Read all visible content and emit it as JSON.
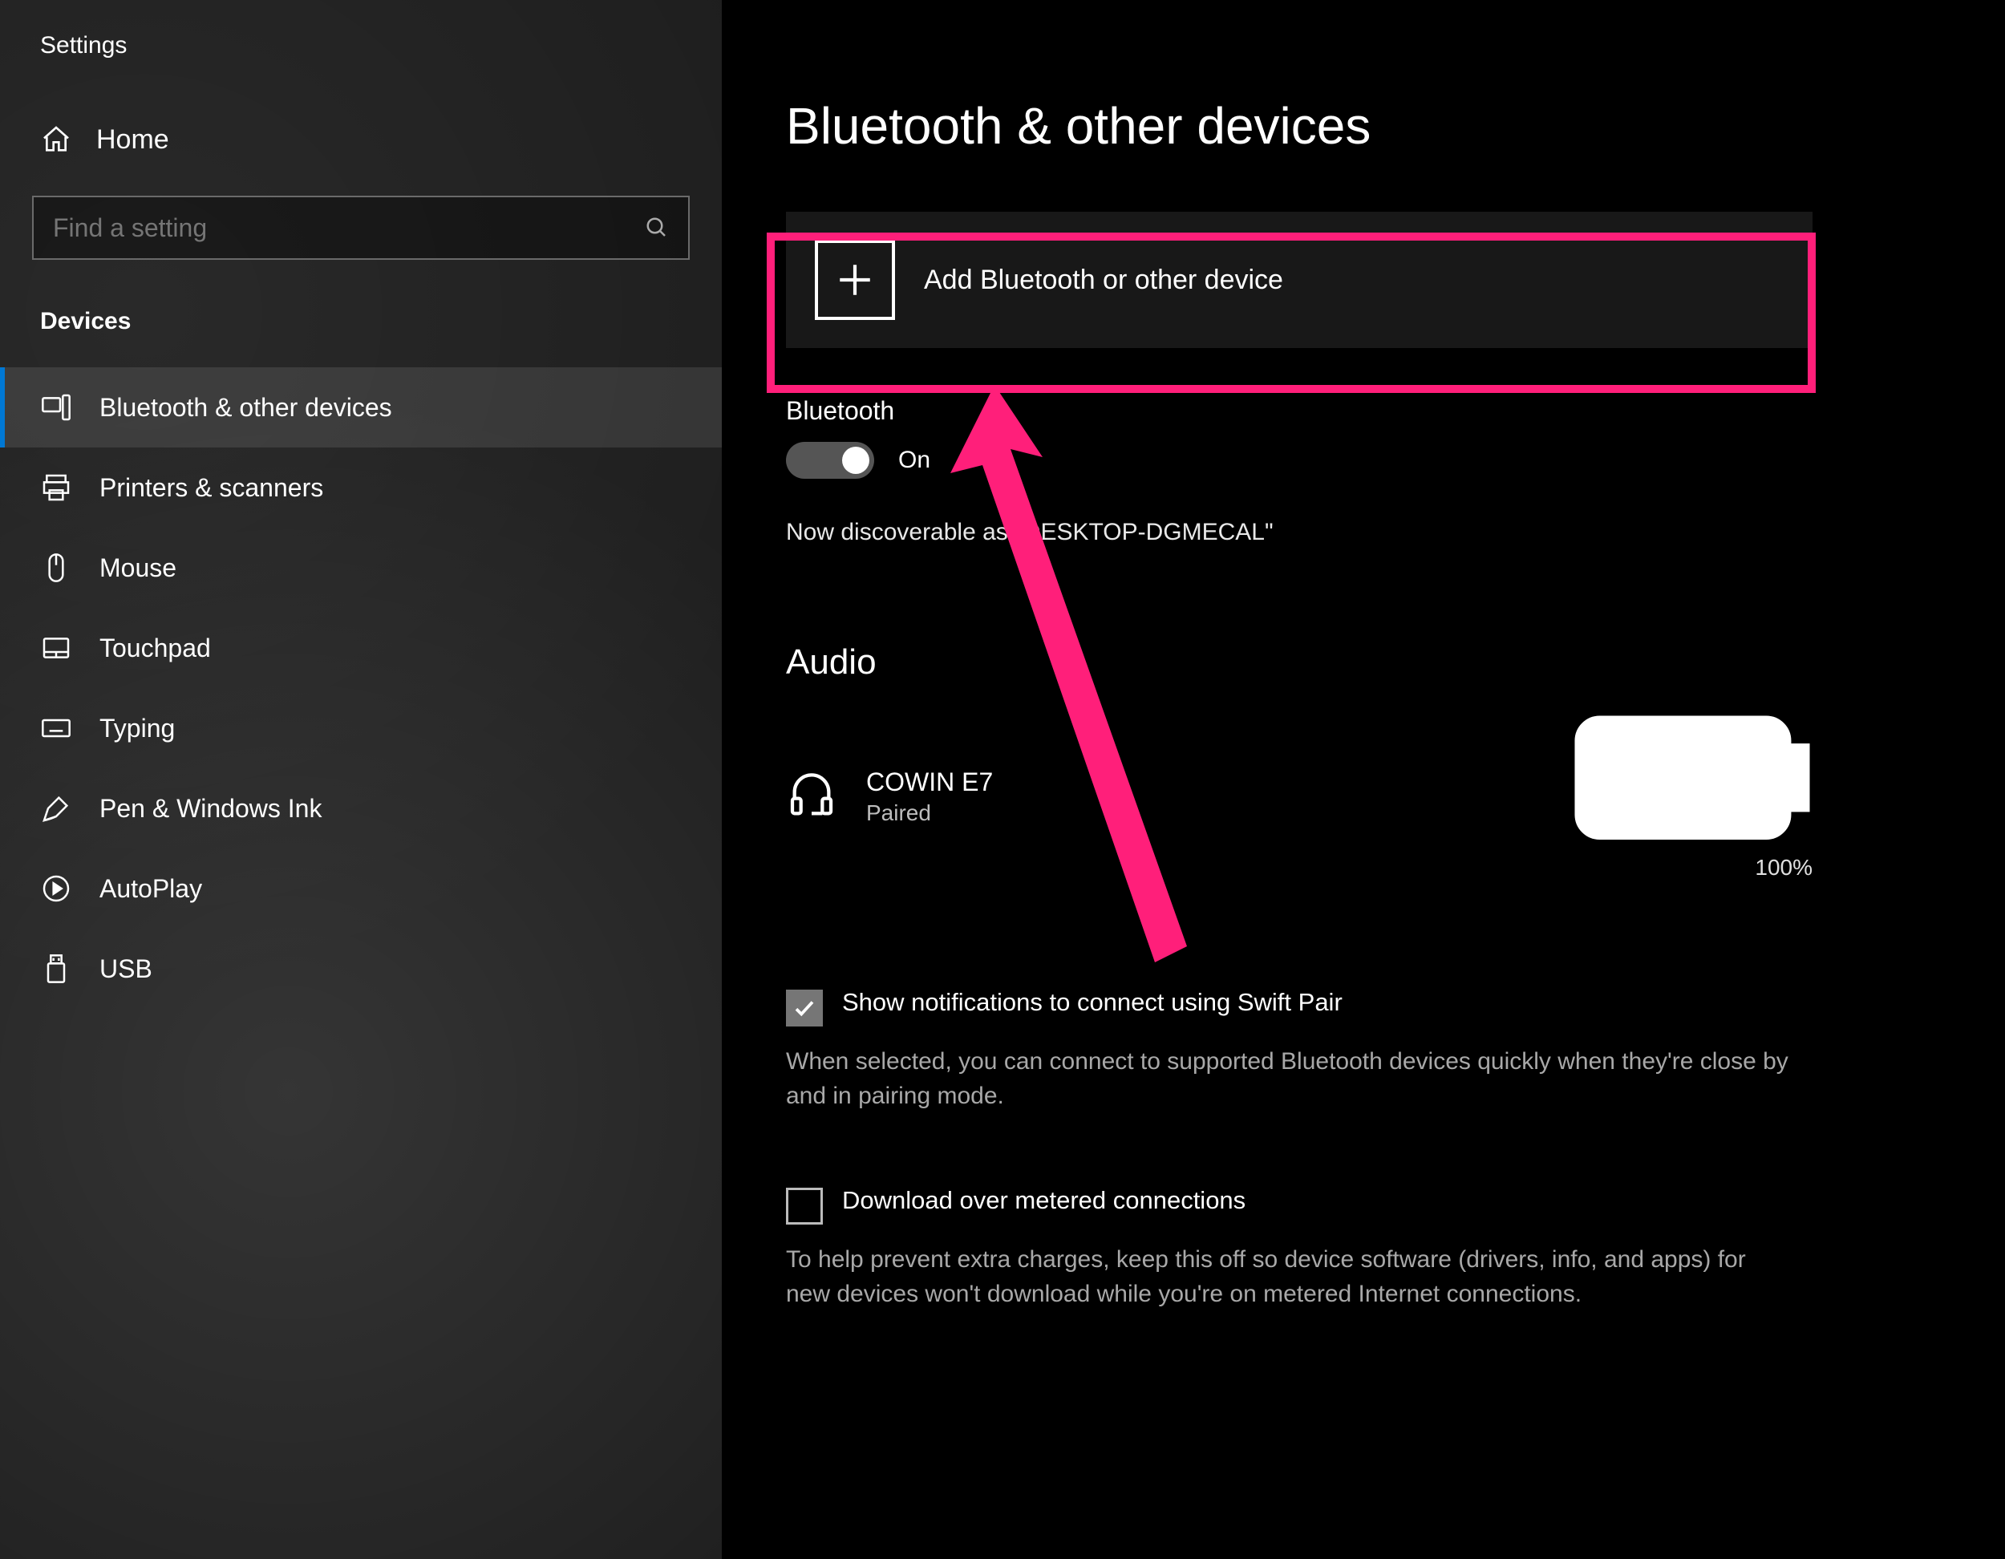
{
  "app_title": "Settings",
  "home_label": "Home",
  "search": {
    "placeholder": "Find a setting"
  },
  "section_label": "Devices",
  "nav": [
    {
      "id": "bluetooth",
      "label": "Bluetooth & other devices",
      "active": true
    },
    {
      "id": "printers",
      "label": "Printers & scanners"
    },
    {
      "id": "mouse",
      "label": "Mouse"
    },
    {
      "id": "touchpad",
      "label": "Touchpad"
    },
    {
      "id": "typing",
      "label": "Typing"
    },
    {
      "id": "pen",
      "label": "Pen & Windows Ink"
    },
    {
      "id": "autoplay",
      "label": "AutoPlay"
    },
    {
      "id": "usb",
      "label": "USB"
    }
  ],
  "main": {
    "title": "Bluetooth & other devices",
    "add_device_label": "Add Bluetooth or other device",
    "bt_heading": "Bluetooth",
    "bt_toggle_state": "On",
    "discoverable_text": "Now discoverable as \"DESKTOP-DGMECAL\"",
    "audio_heading": "Audio",
    "audio_device": {
      "name": "COWIN E7",
      "status": "Paired",
      "battery_pct": "100%"
    },
    "swift_pair": {
      "label": "Show notifications to connect using Swift Pair",
      "desc": "When selected, you can connect to supported Bluetooth devices quickly when they're close by and in pairing mode.",
      "checked": true
    },
    "metered": {
      "label": "Download over metered connections",
      "desc": "To help prevent extra charges, keep this off so device software (drivers, info, and apps) for new devices won't download while you're on metered Internet connections.",
      "checked": false
    }
  },
  "annotation": {
    "color": "#ff1f7a"
  }
}
